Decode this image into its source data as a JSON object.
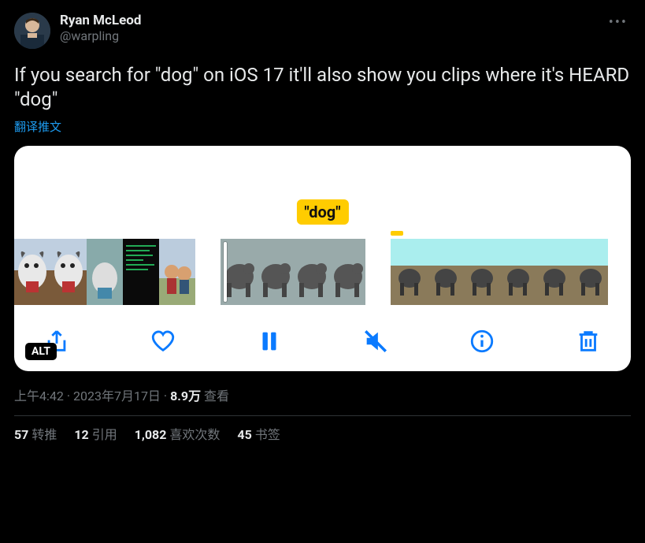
{
  "author": {
    "display_name": "Ryan McLeod",
    "handle": "@warpling"
  },
  "tweet_text": "If you search for \"dog\" on iOS 17 it'll also show you clips where it's HEARD \"dog\"",
  "translate_label": "翻译推文",
  "media": {
    "search_label": "\"dog\"",
    "alt_badge": "ALT",
    "controls": {
      "share": "share",
      "heart": "heart",
      "pause": "pause",
      "mute": "mute",
      "info": "info",
      "trash": "trash"
    }
  },
  "meta": {
    "time": "上午4:42",
    "dot1": " · ",
    "date": "2023年7月17日",
    "dot2": " · ",
    "views_num": "8.9万",
    "views_label": " 查看"
  },
  "stats": {
    "retweets_num": "57",
    "retweets_label": "转推",
    "quotes_num": "12",
    "quotes_label": "引用",
    "likes_num": "1,082",
    "likes_label": "喜欢次数",
    "bookmarks_num": "45",
    "bookmarks_label": "书签"
  }
}
